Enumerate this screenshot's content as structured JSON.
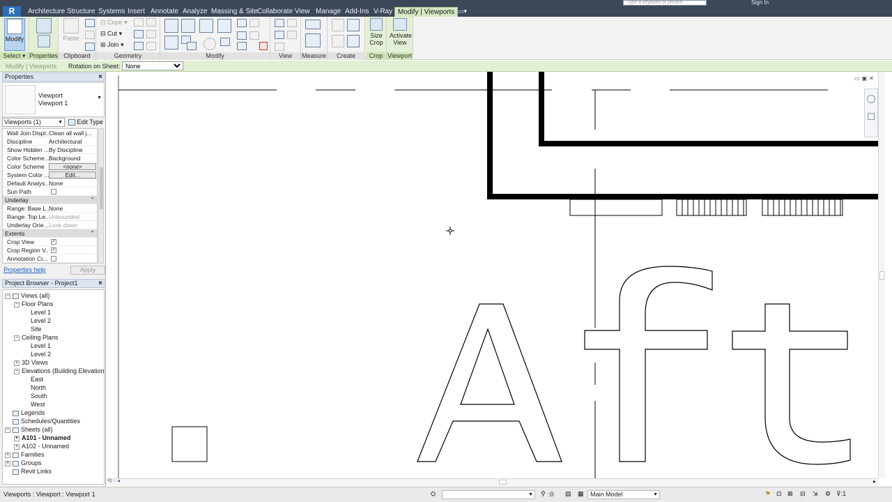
{
  "titlebar": {
    "search_placeholder": "Type a keyword or phrase",
    "signin": "Sign In"
  },
  "ribbon_tabs": [
    {
      "label": "Architecture"
    },
    {
      "label": "Structure"
    },
    {
      "label": "Systems"
    },
    {
      "label": "Insert"
    },
    {
      "label": "Annotate"
    },
    {
      "label": "Analyze"
    },
    {
      "label": "Massing & Site"
    },
    {
      "label": "Collaborate"
    },
    {
      "label": "View"
    },
    {
      "label": "Manage"
    },
    {
      "label": "Add-Ins"
    },
    {
      "label": "V-Ray"
    },
    {
      "label": "Modify | Viewports"
    }
  ],
  "ribbon": {
    "select": {
      "modify": "Modify",
      "label": "Select"
    },
    "properties": {
      "label": "Properties"
    },
    "clipboard": {
      "paste": "Paste",
      "cope": "Cope",
      "cut": "Cut",
      "join": "Join",
      "label": "Clipboard"
    },
    "geometry": {
      "label": "Geometry"
    },
    "modify": {
      "label": "Modify"
    },
    "view": {
      "label": "View"
    },
    "measure": {
      "label": "Measure"
    },
    "create": {
      "label": "Create"
    },
    "crop": {
      "size_crop": "Size Crop",
      "label": "Crop"
    },
    "viewport": {
      "activate_view": "Activate View",
      "label": "Viewport"
    }
  },
  "optbar": {
    "context": "Modify | Viewports",
    "rotation_label": "Rotation on Sheet:",
    "rotation_value": "None"
  },
  "properties": {
    "header": "Properties",
    "type_name": "Viewport",
    "type_sub": "Viewport 1",
    "filter": "Viewports (1)",
    "edit_type": "Edit Type",
    "rows": [
      {
        "k": "Wall Join Displ...",
        "v": "Clean all wall j...",
        "kind": "text"
      },
      {
        "k": "Discipline",
        "v": "Architectural",
        "kind": "text"
      },
      {
        "k": "Show Hidden ...",
        "v": "By Discipline",
        "kind": "text"
      },
      {
        "k": "Color Scheme...",
        "v": "Background",
        "kind": "text"
      },
      {
        "k": "Color Scheme",
        "v": "<none>",
        "kind": "button"
      },
      {
        "k": "System Color ...",
        "v": "Edit...",
        "kind": "button"
      },
      {
        "k": "Default Analys...",
        "v": "None",
        "kind": "text"
      },
      {
        "k": "Sun Path",
        "v": "",
        "kind": "check",
        "checked": false
      },
      {
        "k": "Underlay",
        "v": "",
        "kind": "group"
      },
      {
        "k": "Range: Base L...",
        "v": "None",
        "kind": "text"
      },
      {
        "k": "Range: Top Le...",
        "v": "Unbounded",
        "kind": "grey"
      },
      {
        "k": "Underlay Orie...",
        "v": "Look down",
        "kind": "grey"
      },
      {
        "k": "Extents",
        "v": "",
        "kind": "group"
      },
      {
        "k": "Crop View",
        "v": "",
        "kind": "check",
        "checked": true
      },
      {
        "k": "Crop Region V...",
        "v": "",
        "kind": "check",
        "checked": true
      },
      {
        "k": "Annotation Cr...",
        "v": "",
        "kind": "check",
        "checked": false
      }
    ],
    "help": "Properties help",
    "apply": "Apply"
  },
  "browser": {
    "header": "Project Browser - Project1",
    "nodes": [
      {
        "label": "Views (all)",
        "depth": 0,
        "toggle": "−",
        "icon": true
      },
      {
        "label": "Floor Plans",
        "depth": 1,
        "toggle": "−"
      },
      {
        "label": "Level 1",
        "depth": 2
      },
      {
        "label": "Level 2",
        "depth": 2
      },
      {
        "label": "Site",
        "depth": 2
      },
      {
        "label": "Ceiling Plans",
        "depth": 1,
        "toggle": "−"
      },
      {
        "label": "Level 1",
        "depth": 2
      },
      {
        "label": "Level 2",
        "depth": 2
      },
      {
        "label": "3D Views",
        "depth": 1,
        "toggle": "+"
      },
      {
        "label": "Elevations (Building Elevation)",
        "depth": 1,
        "toggle": "−"
      },
      {
        "label": "East",
        "depth": 2
      },
      {
        "label": "North",
        "depth": 2
      },
      {
        "label": "South",
        "depth": 2
      },
      {
        "label": "West",
        "depth": 2
      },
      {
        "label": "Legends",
        "depth": 0,
        "icon": true
      },
      {
        "label": "Schedules/Quantities",
        "depth": 0,
        "icon": true
      },
      {
        "label": "Sheets (all)",
        "depth": 0,
        "toggle": "−",
        "icon": true
      },
      {
        "label": "A101 - Unnamed",
        "depth": 1,
        "toggle": "+",
        "bold": true
      },
      {
        "label": "A102 - Unnamed",
        "depth": 1,
        "toggle": "+"
      },
      {
        "label": "Families",
        "depth": 0,
        "toggle": "+",
        "icon": true
      },
      {
        "label": "Groups",
        "depth": 0,
        "toggle": "+",
        "icon": true
      },
      {
        "label": "Revit Links",
        "depth": 0,
        "icon": true
      }
    ]
  },
  "statusbar": {
    "message": "Viewports : Viewport : Viewport 1",
    "zero": ":0",
    "model": "Main Model"
  },
  "colors": {
    "ribbon_tab_bg": "#3c4758",
    "context_tab": "#d6e8c2",
    "link": "#1d5fb4"
  }
}
